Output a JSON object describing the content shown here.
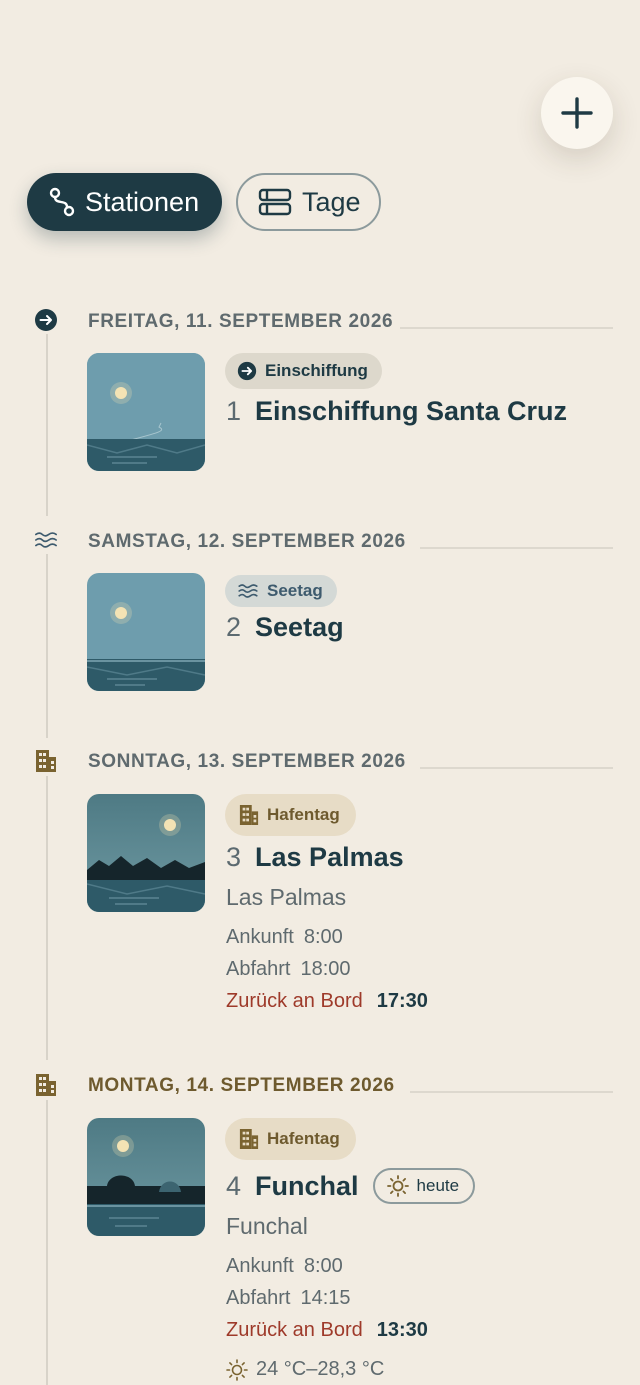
{
  "toolbar": {
    "add_label": "+",
    "segments": [
      {
        "label": "Stationen",
        "icon": "route-icon",
        "selected": true
      },
      {
        "label": "Tage",
        "icon": "list-icon",
        "selected": false
      }
    ]
  },
  "days": [
    {
      "date_label": "FREITAG, 11. SEPTEMBER 2026",
      "icon": "arrow-right-circle-icon",
      "badge": "Einschiffung",
      "number": "1",
      "name": "Einschiffung Santa Cruz"
    },
    {
      "date_label": "SAMSTAG, 12. SEPTEMBER 2026",
      "icon": "waves-icon",
      "badge": "Seetag",
      "number": "2",
      "name": "Seetag"
    },
    {
      "date_label": "SONNTAG, 13. SEPTEMBER 2026",
      "icon": "building-icon",
      "badge": "Hafentag",
      "number": "3",
      "name": "Las Palmas",
      "port": "Las Palmas",
      "arrival_label": "Ankunft",
      "arrival": "8:00",
      "departure_label": "Abfahrt",
      "departure": "18:00",
      "back_label": "Zurück an Bord",
      "back": "17:30"
    },
    {
      "date_label": "MONTAG, 14. SEPTEMBER 2026",
      "icon": "building-icon",
      "badge": "Hafentag",
      "number": "4",
      "name": "Funchal",
      "today_label": "heute",
      "port": "Funchal",
      "arrival_label": "Ankunft",
      "arrival": "8:00",
      "departure_label": "Abfahrt",
      "departure": "14:15",
      "back_label": "Zurück an Bord",
      "back": "13:30",
      "weather": "24 °C–28,3 °C"
    }
  ],
  "colors": {
    "background": "#F2ECE2",
    "primary": "#1E3A44",
    "alert": "#9E3A2A",
    "port_accent": "#6E5A2E"
  }
}
